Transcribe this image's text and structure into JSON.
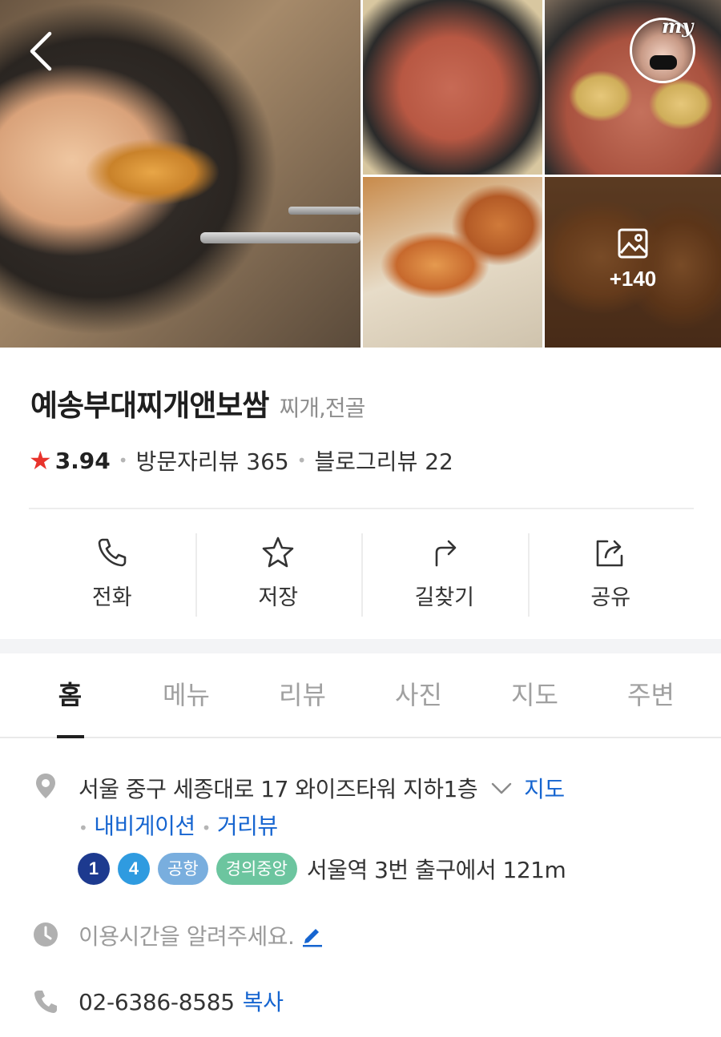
{
  "header": {
    "photo_more_count": "+140",
    "avatar_label": "my"
  },
  "place": {
    "name": "예송부대찌개앤보쌈",
    "category": "찌개,전골",
    "rating": "3.94",
    "visitor_reviews_label": "방문자리뷰 365",
    "blog_reviews_label": "블로그리뷰 22",
    "rating_color": "#e8332c"
  },
  "actions": [
    {
      "label": "전화",
      "icon": "phone-icon"
    },
    {
      "label": "저장",
      "icon": "star-icon"
    },
    {
      "label": "길찾기",
      "icon": "directions-icon"
    },
    {
      "label": "공유",
      "icon": "share-icon"
    }
  ],
  "tabs": [
    {
      "label": "홈",
      "active": true
    },
    {
      "label": "메뉴",
      "active": false
    },
    {
      "label": "리뷰",
      "active": false
    },
    {
      "label": "사진",
      "active": false
    },
    {
      "label": "지도",
      "active": false
    },
    {
      "label": "주변",
      "active": false
    }
  ],
  "address": {
    "text": "서울 중구 세종대로 17 와이즈타워 지하1층",
    "map_link": "지도",
    "navigation_link": "내비게이션",
    "street_view_link": "거리뷰"
  },
  "subway": {
    "lines": [
      {
        "label": "1",
        "color": "#1d3a8f"
      },
      {
        "label": "4",
        "color": "#2f9be0"
      }
    ],
    "pills": [
      {
        "label": "공항",
        "color": "#79aede"
      },
      {
        "label": "경의중앙",
        "color": "#6cc59f"
      }
    ],
    "text": "서울역 3번 출구에서 121m"
  },
  "hours": {
    "text": "이용시간을 알려주세요."
  },
  "phone": {
    "number": "02-6386-8585",
    "copy_label": "복사"
  },
  "colors": {
    "link_blue": "#1665d0",
    "muted_text": "#9b9b9b"
  }
}
